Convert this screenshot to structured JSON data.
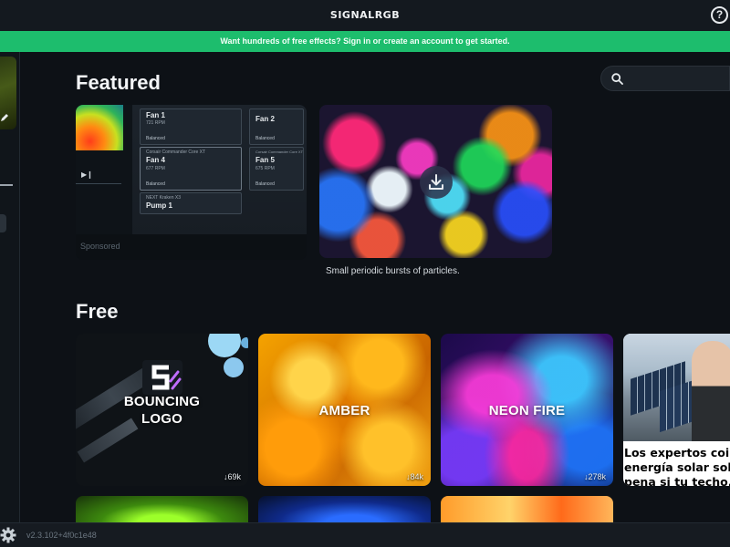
{
  "app": {
    "brand": "SIGNALRGB"
  },
  "banner": {
    "text": "Want hundreds of free effects? Sign in or create an account to get started."
  },
  "featured": {
    "title": "Featured",
    "sponsored": {
      "label": "Sponsored",
      "fans": [
        {
          "subtitle": "",
          "name": "Fan 1",
          "rpm": "721 RPM",
          "mode": "Balanced"
        },
        {
          "subtitle": "",
          "name": "Fan 2",
          "rpm": "",
          "mode": "Balanced"
        },
        {
          "subtitle": "Corsair Commander Core XT",
          "name": "Fan 4",
          "rpm": "677 RPM",
          "mode": "Balanced"
        },
        {
          "subtitle": "Corsair Commander Core XT",
          "name": "Fan 5",
          "rpm": "675 RPM",
          "mode": "Balanced"
        },
        {
          "subtitle": "NEXT Kraken X3",
          "name": "Pump 1",
          "rpm": "",
          "mode": ""
        }
      ]
    },
    "effect": {
      "description": "Small periodic bursts of particles."
    }
  },
  "search": {
    "placeholder": ""
  },
  "free": {
    "title": "Free",
    "cards": [
      {
        "title_line1": "BOUNCING",
        "title_line2": "LOGO",
        "downloads": "↓69k"
      },
      {
        "title": "AMBER",
        "downloads": "↓84k"
      },
      {
        "title": "NEON FIRE",
        "downloads": "↓278k"
      }
    ],
    "ad": {
      "line1": "Los expertos coin",
      "line2": "energía solar solo",
      "line3": "pena si tu techo..."
    }
  },
  "footer": {
    "version": "v2.3.102+4f0c1e48"
  },
  "colors": {
    "accent_green": "#1dbd6d",
    "background": "#0d1116"
  },
  "icons": [
    "help-icon",
    "search-icon",
    "download-icon",
    "gear-icon",
    "pencil-icon",
    "play-icon"
  ]
}
